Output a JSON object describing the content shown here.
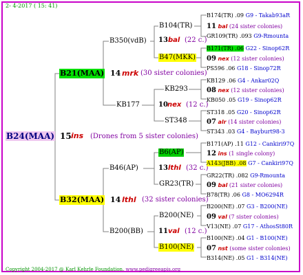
{
  "header": "2- 4-2017 ( 15: 41)",
  "footer": {
    "copyright": "Copyright 2004-2017 @ Karl Kehrle Foundation.",
    "url": "www.pedigreeapis.org"
  },
  "root": {
    "name": "B24(MAA)",
    "num": "15",
    "ins": "ins",
    "note": "(Drones from 5 sister colonies)"
  },
  "gen1": [
    {
      "name": "B21(MAA)",
      "num": "14",
      "ins": "mrk",
      "note": "(30 sister colonies)"
    },
    {
      "name": "B32(MAA)",
      "num": "14",
      "ins": "lthl",
      "note": "(32 sister colonies)"
    }
  ],
  "gen2": [
    {
      "name": "B350(vdB)",
      "num": "",
      "ins": "",
      "note": ""
    },
    {
      "name": "KB177",
      "num": "10",
      "ins": "nex",
      "note": "(12 c.)"
    },
    {
      "name": "B46(AP)",
      "num": "13",
      "ins": "lthl",
      "note": "(32 c.)"
    },
    {
      "name": "B200(BB)",
      "num": "11",
      "ins": "val",
      "note": "(12 c.)"
    }
  ],
  "gen3": [
    {
      "name": "B104(TR)",
      "num": "13",
      "ins": "bal",
      "note": "(22 c.)"
    },
    {
      "name": "B47(MKK)",
      "num": "",
      "ins": "",
      "note": ""
    },
    {
      "name": "KB293",
      "num": "",
      "ins": "",
      "note": ""
    },
    {
      "name": "ST348",
      "num": "07",
      "ins": "alr",
      "note": ""
    },
    {
      "name": "B6(AP)",
      "num": "",
      "ins": "",
      "note": ""
    },
    {
      "name": "GR23(TR)",
      "num": "",
      "ins": "",
      "note": ""
    },
    {
      "name": "B200(NE)",
      "num": "",
      "ins": "",
      "note": ""
    },
    {
      "name": "B100(NE)",
      "num": "",
      "ins": "",
      "note": ""
    }
  ],
  "gen4": [
    {
      "line": "B174(TR) .09",
      "id": "G9 - Takab93aR"
    },
    {
      "num": "11",
      "ins": "bal",
      "note": "(24 sister colonies)"
    },
    {
      "line": "GR109(TR) .093",
      "id": "G9-Rmounta"
    },
    {
      "line": "B171(TR) .06",
      "id": "G22 - Sinop62R"
    },
    {
      "num": "09",
      "ins": "nex",
      "note": "(12 sister colonies)"
    },
    {
      "line": "PS596 .06",
      "id": "G18 - Sinop72R"
    },
    {
      "line": "KB129 .06",
      "id": "G4 - Ankar02Q"
    },
    {
      "num": "08",
      "ins": "nex",
      "note": "(12 sister colonies)"
    },
    {
      "line": "KB050 .05",
      "id": "G19 - Sinop62R"
    },
    {
      "line": "ST318 .05",
      "id": "G20 - Sinop62R"
    },
    {
      "num": "07",
      "ins": "alr",
      "note": "(14 sister colonies)"
    },
    {
      "line": "ST343 .03",
      "id": "G4 - Bayburt98-3"
    },
    {
      "line": "B171(AP) .11",
      "id": "G12 - Cankiri97Q"
    },
    {
      "num": "12",
      "ins": "ins",
      "note": "(1 single colony)"
    },
    {
      "line": "A143(JBB) .08",
      "id": "G7 - Cankiri97Q"
    },
    {
      "line": "GR22(TR) .082",
      "id": "G9-Rmounta"
    },
    {
      "num": "09",
      "ins": "bal",
      "note": "(21 sister colonies)"
    },
    {
      "line": "B78(TR) .06",
      "id": "G8 - MO6294R"
    },
    {
      "line": "B200(NE) .07",
      "id": "G3 - B200(NE)"
    },
    {
      "num": "09",
      "ins": "val",
      "note": "(7 sister colonies)"
    },
    {
      "line": "V13(NE) .07",
      "id": "G17 - AthosSt80R"
    },
    {
      "line": "B100(NE) .04",
      "id": "G1 - B100(NE)"
    },
    {
      "num": "07",
      "ins": "nst",
      "note": "(some sister colonies)"
    },
    {
      "line": "B314(NE) .05",
      "id": "G1 - B314(NE)"
    }
  ],
  "colors": {
    "border": "#c800c8",
    "lines": "#808080",
    "navy": "#000080",
    "red": "#cc0000",
    "purple": "#8000a0",
    "green_highlight": "#00e000",
    "yellow_highlight": "#ffff00",
    "pink_highlight": "#f0c8f0"
  }
}
